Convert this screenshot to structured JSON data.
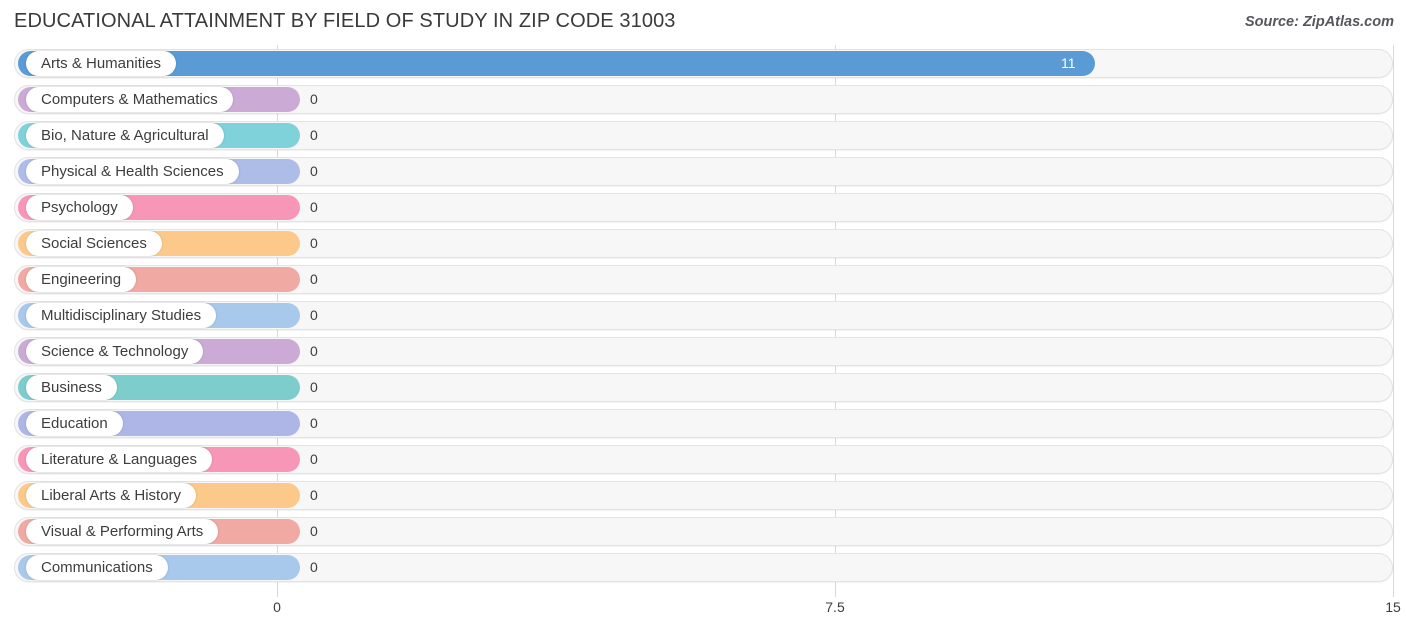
{
  "header": {
    "title": "EDUCATIONAL ATTAINMENT BY FIELD OF STUDY IN ZIP CODE 31003",
    "source": "Source: ZipAtlas.com"
  },
  "chart_data": {
    "type": "bar",
    "orientation": "horizontal",
    "title": "EDUCATIONAL ATTAINMENT BY FIELD OF STUDY IN ZIP CODE 31003",
    "xlabel": "",
    "ylabel": "",
    "xlim": [
      0,
      15
    ],
    "grid": true,
    "legend": "none",
    "xticks": [
      "0",
      "7.5",
      "15"
    ],
    "xtick_values": [
      0,
      7.5,
      15
    ],
    "categories": [
      "Arts & Humanities",
      "Computers & Mathematics",
      "Bio, Nature & Agricultural",
      "Physical & Health Sciences",
      "Psychology",
      "Social Sciences",
      "Engineering",
      "Multidisciplinary Studies",
      "Science & Technology",
      "Business",
      "Education",
      "Literature & Languages",
      "Liberal Arts & History",
      "Visual & Performing Arts",
      "Communications"
    ],
    "values": [
      11,
      0,
      0,
      0,
      0,
      0,
      0,
      0,
      0,
      0,
      0,
      0,
      0,
      0,
      0
    ],
    "value_labels": [
      "11",
      "0",
      "0",
      "0",
      "0",
      "0",
      "0",
      "0",
      "0",
      "0",
      "0",
      "0",
      "0",
      "0",
      "0"
    ],
    "colors": [
      "#5b9bd5",
      "#cbaad6",
      "#7fd2da",
      "#aebce8",
      "#f896b8",
      "#fcc98a",
      "#f0a9a3",
      "#a8c8ec",
      "#cbaad6",
      "#7ecdcd",
      "#aeb6e8",
      "#f896b8",
      "#fcc98a",
      "#f0a9a3",
      "#a8c8ec"
    ]
  },
  "colors": {
    "track_fill": "#f7f7f7",
    "track_border": "#e3e3e3",
    "gridline": "#d8d8d8",
    "text": "#3d3d3d",
    "accent": "#5b9bd5"
  }
}
